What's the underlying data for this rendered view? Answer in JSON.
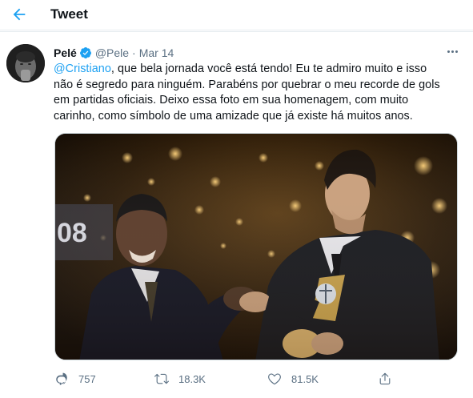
{
  "header": {
    "title": "Tweet"
  },
  "tweet": {
    "author_name": "Pelé",
    "handle": "@Pele",
    "separator": "·",
    "date": "Mar 14",
    "mention": "@Cristiano",
    "text_line1": ", que bela jornada você está tendo! Eu te admiro muito e isso",
    "text_line2": "não é segredo para ninguém. Parabéns por quebrar o meu recorde de gols",
    "text_line3": "em partidas oficiais. Deixo essa foto em sua homenagem, com muito",
    "text_line4": "carinho, como símbolo de uma amizade que já existe há muitos anos.",
    "media_overlay_text": "08"
  },
  "actions": {
    "replies": "757",
    "retweets": "18.3K",
    "likes": "81.5K"
  },
  "colors": {
    "accent": "#1da1f2",
    "secondary_text": "#5b7083",
    "divider": "#e6ecf0"
  },
  "icons": {
    "back": "arrow-left-icon",
    "verified": "verified-badge-icon",
    "more": "more-horizontal-icon",
    "reply": "reply-icon",
    "retweet": "retweet-icon",
    "like": "heart-icon",
    "share": "share-icon"
  }
}
